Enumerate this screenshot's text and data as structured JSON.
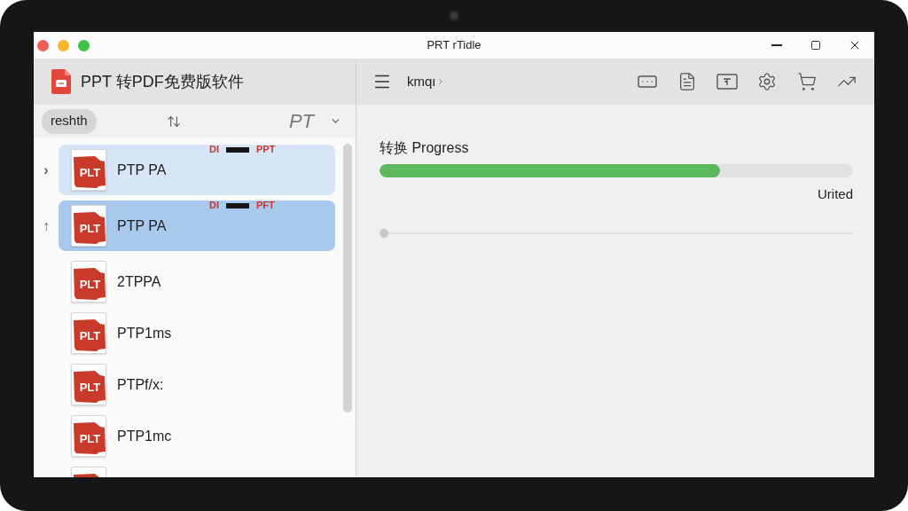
{
  "window": {
    "title": "PRT rTidle"
  },
  "sidebar": {
    "app_name": "PPT 转PDF免费版软件",
    "filter_chip": "reshth",
    "sort_label": "PT",
    "items": [
      {
        "marker": "›",
        "label": "PTP PA",
        "badge": "PLT",
        "highlighted": true,
        "selected": false,
        "overlay": {
          "left": "DI",
          "right": "PPT"
        }
      },
      {
        "marker": "↑",
        "label": "PTP PA",
        "badge": "PLT",
        "highlighted": false,
        "selected": true,
        "overlay": {
          "left": "DI",
          "right": "PFT"
        }
      },
      {
        "label": "2TPPA",
        "badge": "PLT",
        "highlighted": false,
        "selected": false
      },
      {
        "label": "PTP1ms",
        "badge": "PLT",
        "highlighted": false,
        "selected": false
      },
      {
        "label": "PTPf/x:",
        "badge": "PLT",
        "highlighted": false,
        "selected": false
      },
      {
        "label": "PTP1mc",
        "badge": "PLT",
        "highlighted": false,
        "selected": false
      },
      {
        "highlighted": false,
        "selected": false
      }
    ]
  },
  "main": {
    "breadcrumb": "kmqı",
    "progress": {
      "label": "转换 Progress",
      "level": 0.72,
      "status": "Urited"
    },
    "slider": {
      "level": 0
    }
  }
}
